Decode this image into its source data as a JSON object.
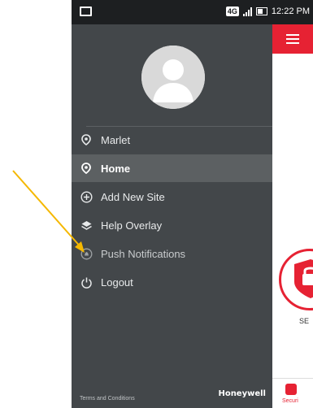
{
  "statusbar": {
    "network": "4G",
    "time": "12:22 PM"
  },
  "drawer": {
    "items": [
      {
        "label": "Marlet",
        "icon": "location-pin-icon"
      },
      {
        "label": "Home",
        "icon": "location-pin-icon",
        "active": true
      },
      {
        "label": "Add New Site",
        "icon": "plus-circle-icon"
      },
      {
        "label": "Help Overlay",
        "icon": "layers-icon"
      },
      {
        "label": "Push Notifications",
        "icon": "bell-icon"
      },
      {
        "label": "Logout",
        "icon": "power-icon"
      }
    ],
    "footer_terms": "Terms and Conditions",
    "footer_logo": "Honeywell"
  },
  "content": {
    "tile_label": "SE",
    "bottom_tab_label": "Securi"
  },
  "colors": {
    "accent": "#e62233",
    "drawer_bg": "#43474a",
    "active_bg": "#5c6062",
    "arrow": "#f5b800"
  }
}
